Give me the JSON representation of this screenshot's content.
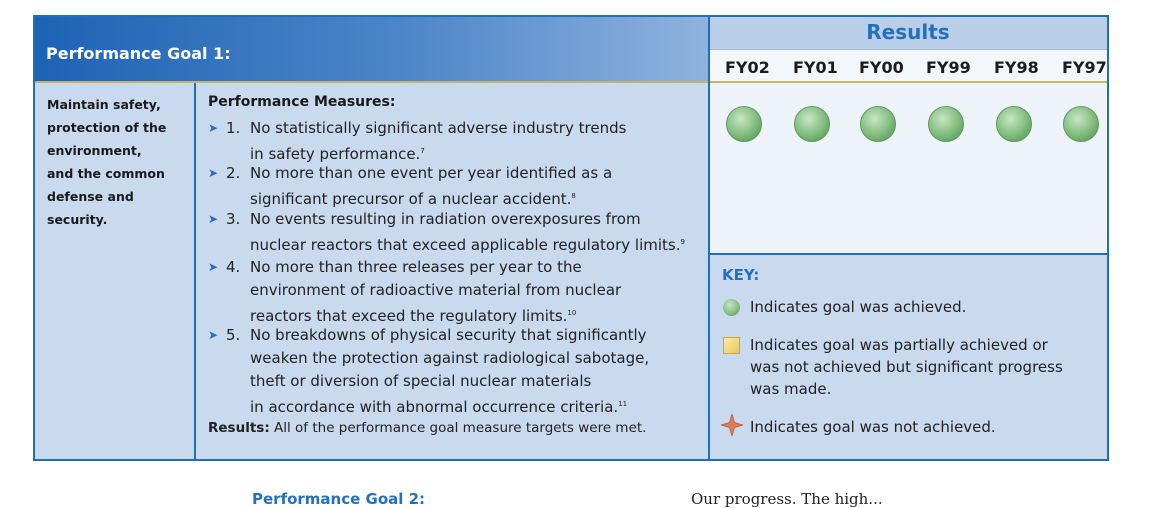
{
  "table": {
    "goal_header": "Performance Goal 1:",
    "results_header": "Results",
    "years": [
      "FY02",
      "FY01",
      "FY00",
      "FY99",
      "FY98",
      "FY97"
    ],
    "goal_text": "Maintain safety,\nprotection of the\nenvironment,\nand the common\ndefense and\nsecurity.",
    "measures_title": "Performance Measures:",
    "measures": [
      {
        "num": "1.",
        "text": "No statistically significant adverse industry trends\nin safety performance.",
        "note": "7"
      },
      {
        "num": "2.",
        "text": "No more than one event per year identified as a\nsignificant precursor of a nuclear accident.",
        "note": "8"
      },
      {
        "num": "3.",
        "text": "No events resulting in radiation overexposures from\nnuclear reactors that exceed applicable regulatory limits.",
        "note": "9"
      },
      {
        "num": "4.",
        "text": "No more than three releases per year to the\nenvironment of radioactive material from nuclear\nreactors that exceed the regulatory limits.",
        "note": "10"
      },
      {
        "num": "5.",
        "text": "No breakdowns of physical security that significantly\nweaken the protection against radiological sabotage,\ntheft or diversion of special nuclear materials\nin accordance with abnormal occurrence criteria.",
        "note": "11"
      }
    ],
    "results_label": "Results:",
    "results_text": "All of the performance goal measure targets were met.",
    "status": [
      "achieved",
      "achieved",
      "achieved",
      "achieved",
      "achieved",
      "achieved"
    ]
  },
  "key": {
    "title": "KEY:",
    "achieved": "Indicates goal was achieved.",
    "partial": "Indicates goal was partially achieved or\nwas not achieved but significant progress\nwas made.",
    "not_achieved": "Indicates goal was not achieved.",
    "colors": {
      "achieved": "#7fbb7c",
      "partial": "#e6c75a",
      "not_achieved": "#e07a5a"
    }
  },
  "below": {
    "left_heading": "Performance Goal 2:",
    "right_text": "Our progress. The high..."
  }
}
